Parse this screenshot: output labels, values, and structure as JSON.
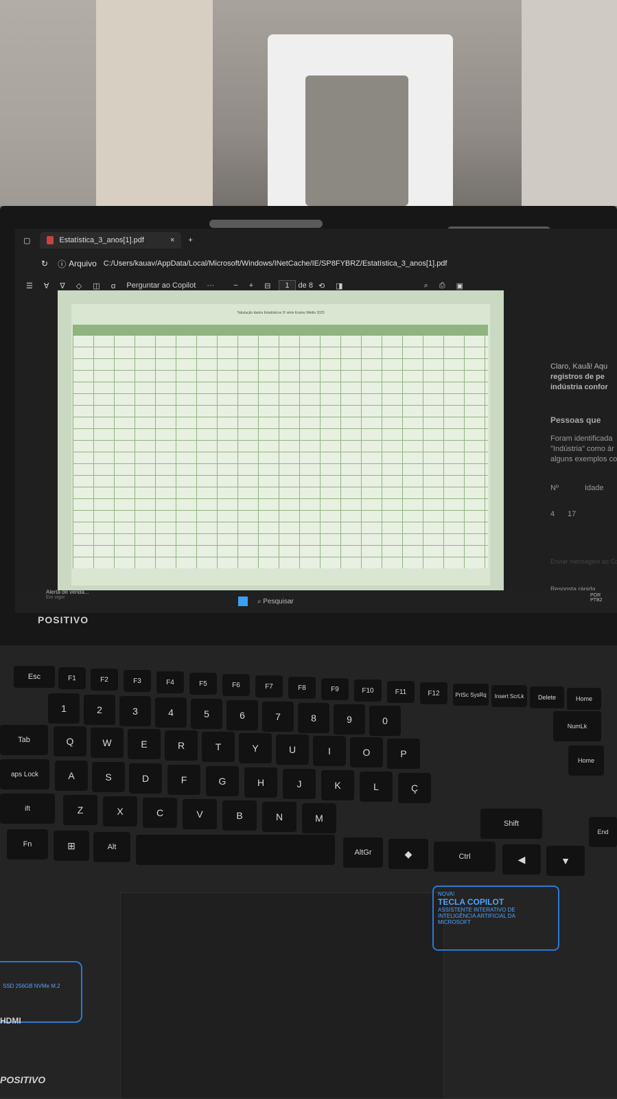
{
  "browser": {
    "tab_title": "Estatística_3_anos[1].pdf",
    "tab_close": "×",
    "new_tab": "+",
    "address_prefix": "Arquivo",
    "address": "C:/Users/kauav/AppData/Local/Microsoft/Windows/INetCache/IE/SP8FYBRZ/Estatística_3_anos[1].pdf"
  },
  "pdf_toolbar": {
    "ask_copilot": "Perguntar ao Copilot",
    "more": "···",
    "zoom_out": "−",
    "zoom_in": "+",
    "page_current": "1",
    "page_total": "de 8"
  },
  "document": {
    "title": "Tabulação dados Estatísticos 3ª série Ensino Médio 2025"
  },
  "copilot_pane": {
    "lines": [
      "Claro, Kauã! Aqu",
      "registros de pe",
      "indústria confor",
      "Pessoas que",
      "Foram identificada",
      "\"Indústria\" como ár",
      "alguns exemplos co",
      "Nº",
      "Idade",
      "4",
      "17",
      "Enviar mensagem ao Co",
      "Resposta rápida"
    ]
  },
  "taskbar": {
    "notification": "Alerta de venda...",
    "notification_sub": "Em vigor",
    "search": "Pesquisar",
    "lang": "POR",
    "lang_sub": "PTB2"
  },
  "laptop": {
    "brand": "POSITIVO",
    "copilot_badge_new": "NOVA!",
    "copilot_badge_title": "TECLA COPILOT",
    "copilot_badge_text": "ASSISTENTE INTERATIVO DE INTELIGÊNCIA ARTIFICIAL DA MICROSOFT",
    "ssd_text": "SSD 256GB NVMe M.2",
    "hdmi": "HDMI",
    "footer_brand": "POSITIVO"
  },
  "keys": {
    "esc": "Esc",
    "f1": "F1",
    "f2": "F2",
    "f3": "F3",
    "f4": "F4",
    "f5": "F5",
    "f6": "F6",
    "f7": "F7",
    "f8": "F8",
    "f9": "F9",
    "f10": "F10",
    "f11": "F11",
    "f12": "F12",
    "prtsc": "PrtSc SysRq",
    "insert": "Insert ScrLk",
    "delete": "Delete",
    "home": "Home",
    "tab": "Tab",
    "caps": "aps Lock",
    "shift_left": "ift",
    "fn": "Fn",
    "alt": "Alt",
    "altgr": "AltGr",
    "ctrl": "Ctrl",
    "shift": "Shift",
    "numlk": "NumLk",
    "end": "End",
    "q": "Q",
    "w": "W",
    "e": "E",
    "r": "R",
    "t": "T",
    "y": "Y",
    "u": "U",
    "i": "I",
    "o": "O",
    "p": "P",
    "a": "A",
    "s": "S",
    "d": "D",
    "f": "F",
    "g": "G",
    "h": "H",
    "j": "J",
    "k": "K",
    "l": "L",
    "c_cedilla": "Ç",
    "z": "Z",
    "x": "X",
    "c": "C",
    "v": "V",
    "b": "B",
    "n": "N",
    "m": "M",
    "n1": "1",
    "n2": "2",
    "n3": "3",
    "n4": "4",
    "n5": "5",
    "n6": "6",
    "n7": "7",
    "n8": "8",
    "n9": "9",
    "n0": "0"
  }
}
